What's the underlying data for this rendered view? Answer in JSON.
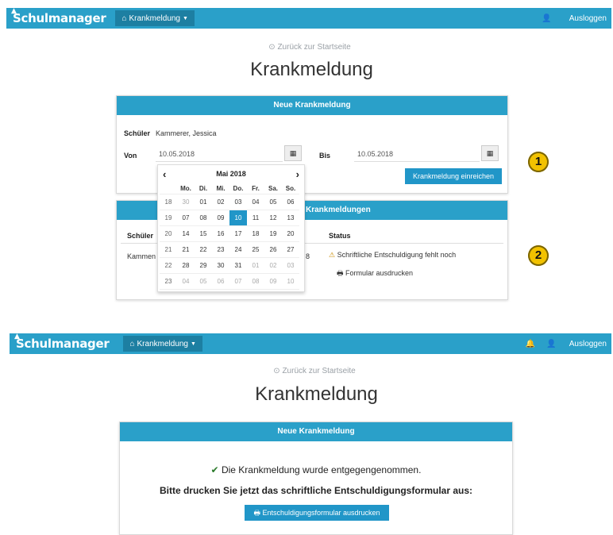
{
  "top": {
    "brand": "Schulmanager",
    "nav_menu": "Krankmeldung",
    "logout": "Ausloggen",
    "back_link": "Zurück zur Startseite",
    "page_title": "Krankmeldung",
    "panel_title": "Neue Krankmeldung",
    "schueler_label": "Schüler",
    "schueler_value": "Kammerer, Jessica",
    "von_label": "Von",
    "von_value": "10.05.2018",
    "bis_label": "Bis",
    "bis_value": "10.05.2018",
    "submit_label": "Krankmeldung einreichen",
    "list_title_fragment": "Krankmeldungen",
    "col_schueler": "Schüler",
    "col_status": "Status",
    "row_name": "Kammen",
    "row_partial": "8",
    "status_warning": "Schriftliche Entschuldigung fehlt noch",
    "print_form": "Formular ausdrucken",
    "callout_1": "1",
    "callout_2": "2"
  },
  "calendar": {
    "month": "Mai 2018",
    "prev": "‹",
    "next": "›",
    "weekdays": [
      "Mo.",
      "Di.",
      "Mi.",
      "Do.",
      "Fr.",
      "Sa.",
      "So."
    ],
    "weeks": [
      {
        "wk": "18",
        "days": [
          "30",
          "01",
          "02",
          "03",
          "04",
          "05",
          "06"
        ]
      },
      {
        "wk": "19",
        "days": [
          "07",
          "08",
          "09",
          "10",
          "11",
          "12",
          "13"
        ]
      },
      {
        "wk": "20",
        "days": [
          "14",
          "15",
          "16",
          "17",
          "18",
          "19",
          "20"
        ]
      },
      {
        "wk": "21",
        "days": [
          "21",
          "22",
          "23",
          "24",
          "25",
          "26",
          "27"
        ]
      },
      {
        "wk": "22",
        "days": [
          "28",
          "29",
          "30",
          "31",
          "01",
          "02",
          "03"
        ]
      },
      {
        "wk": "23",
        "days": [
          "04",
          "05",
          "06",
          "07",
          "08",
          "09",
          "10"
        ]
      }
    ],
    "selected": "10"
  },
  "bottom": {
    "brand": "Schulmanager",
    "nav_menu": "Krankmeldung",
    "logout": "Ausloggen",
    "back_link": "Zurück zur Startseite",
    "page_title": "Krankmeldung",
    "panel_title": "Neue Krankmeldung",
    "success_msg": "Die Krankmeldung wurde entgegengenommen.",
    "instruction": "Bitte drucken Sie jetzt das schriftliche Entschuldigungsformular aus:",
    "print_button": "Entschuldigungsformular ausdrucken"
  }
}
